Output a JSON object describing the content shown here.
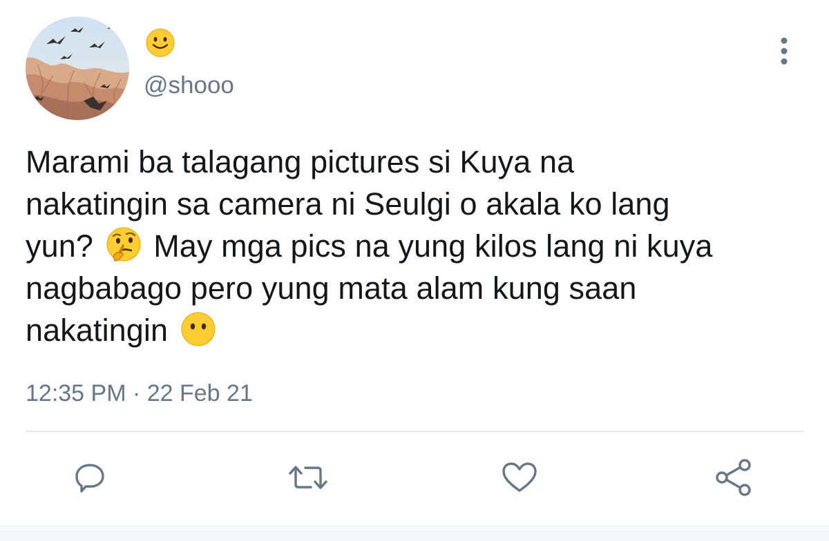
{
  "author": {
    "display_name_emoji": "slightly-smiling-face",
    "handle": "@shooo",
    "avatar": "birds-over-trees-photo"
  },
  "tweet": {
    "lines": [
      "Marami ba talagang pictures si Kuya na",
      "nakatingin sa camera ni Seulgi o akala ko lang",
      "yun?",
      "May mga pics na yung kilos lang ni kuya",
      "nagbabago pero yung mata alam kung saan",
      "nakatingin"
    ],
    "inline_emojis": [
      "thinking-face",
      "face-without-mouth"
    ],
    "timestamp": "12:35 PM · 22 Feb 21"
  },
  "actions": [
    {
      "name": "reply",
      "icon": "reply-icon"
    },
    {
      "name": "retweet",
      "icon": "retweet-icon"
    },
    {
      "name": "like",
      "icon": "heart-icon"
    },
    {
      "name": "share",
      "icon": "share-icon"
    }
  ],
  "colors": {
    "text": "#14171a",
    "secondary": "#657786",
    "divider": "#e1e8ed",
    "emoji_yellow": "#ffcc33"
  }
}
